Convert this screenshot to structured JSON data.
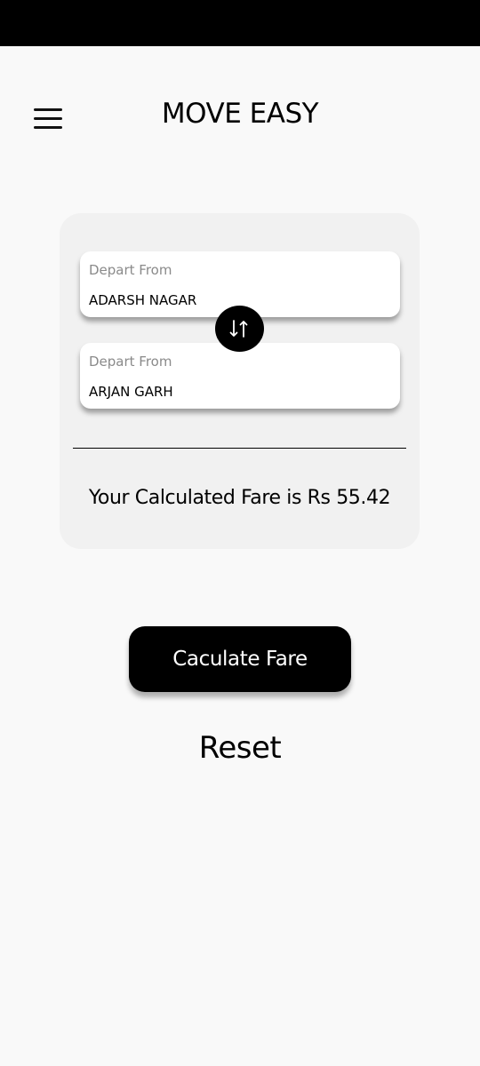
{
  "app": {
    "title": "MOVE EASY"
  },
  "form": {
    "from": {
      "label": "Depart From",
      "value": "ADARSH NAGAR"
    },
    "to": {
      "label": "Depart From",
      "value": "ARJAN GARH"
    }
  },
  "result": {
    "text": "Your Calculated Fare is Rs 55.42"
  },
  "actions": {
    "calculate_label": "Caculate Fare",
    "reset_label": "Reset"
  },
  "icons": {
    "menu": "hamburger-menu-icon",
    "swap": "swap-vertical-icon"
  },
  "colors": {
    "background": "#f9f9f9",
    "card": "#f1f1f1",
    "primary": "#000000",
    "label_gray": "#8a8a8a"
  }
}
